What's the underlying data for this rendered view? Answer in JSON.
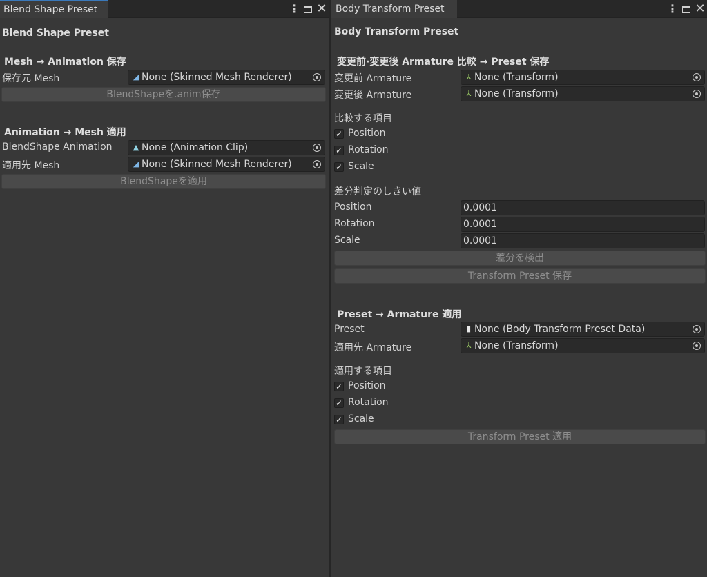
{
  "left": {
    "tab_label": "Blend Shape Preset",
    "title": "Blend Shape Preset",
    "section_save": "Mesh → Animation 保存",
    "source_mesh_label": "保存元 Mesh",
    "source_mesh_value": "None (Skinned Mesh Renderer)",
    "save_button": "BlendShapeを.anim保存",
    "section_apply": "Animation → Mesh 適用",
    "anim_label": "BlendShape Animation",
    "anim_value": "None (Animation Clip)",
    "target_mesh_label": "適用先 Mesh",
    "target_mesh_value": "None (Skinned Mesh Renderer)",
    "apply_button": "BlendShapeを適用"
  },
  "right": {
    "tab_label": "Body Transform Preset",
    "title": "Body Transform Preset",
    "section_compare": "変更前·変更後 Armature 比較 → Preset 保存",
    "before_label": "変更前 Armature",
    "before_value": "None (Transform)",
    "after_label": "変更後 Armature",
    "after_value": "None (Transform)",
    "compare_items_label": "比較する項目",
    "compare_items": [
      {
        "label": "Position",
        "checked": true
      },
      {
        "label": "Rotation",
        "checked": true
      },
      {
        "label": "Scale",
        "checked": true
      }
    ],
    "threshold_label": "差分判定のしきい値",
    "thresholds": [
      {
        "label": "Position",
        "value": "0.0001"
      },
      {
        "label": "Rotation",
        "value": "0.0001"
      },
      {
        "label": "Scale",
        "value": "0.0001"
      }
    ],
    "detect_button": "差分を検出",
    "save_button": "Transform Preset 保存",
    "section_apply": "Preset → Armature 適用",
    "preset_label": "Preset",
    "preset_value": "None (Body Transform Preset Data)",
    "target_label": "適用先 Armature",
    "target_value": "None (Transform)",
    "apply_items_label": "適用する項目",
    "apply_items": [
      {
        "label": "Position",
        "checked": true
      },
      {
        "label": "Rotation",
        "checked": true
      },
      {
        "label": "Scale",
        "checked": true
      }
    ],
    "apply_button": "Transform Preset 適用"
  },
  "icons": {
    "menu": "kebab-menu-icon",
    "maximize": "maximize-icon",
    "close": "close-icon",
    "mesh": "skinned-mesh-icon",
    "anim": "animation-clip-icon",
    "transform": "transform-icon",
    "asset": "asset-file-icon",
    "picker": "object-picker-icon",
    "check": "checkmark-icon"
  },
  "colors": {
    "background": "#383838",
    "field": "#2a2a2a",
    "button": "#4a4a4a",
    "tab_accent": "#3a79bb"
  }
}
